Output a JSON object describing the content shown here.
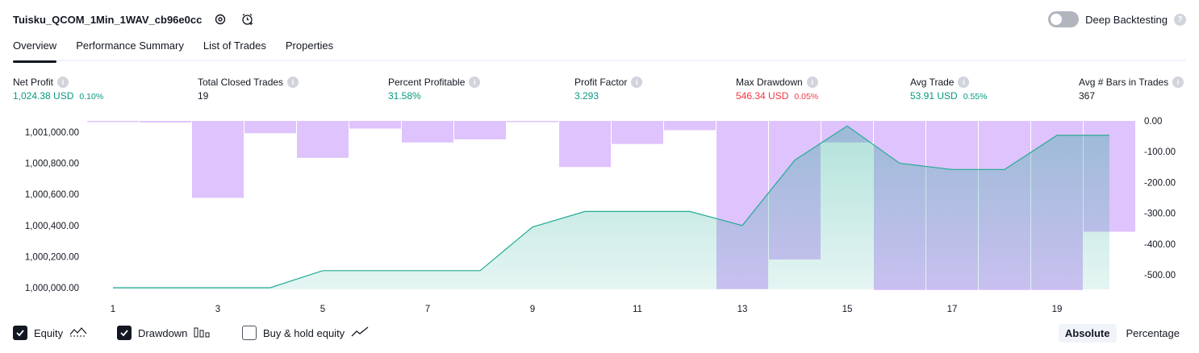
{
  "header": {
    "strategy_name": "Tuisku_QCOM_1Min_1WAV_cb96e0cc",
    "settings_icon": "gear-icon",
    "alert_icon": "add-alert-clock-icon",
    "deep_backtesting_label": "Deep Backtesting",
    "deep_backtesting_enabled": false
  },
  "tabs": [
    {
      "label": "Overview",
      "active": true
    },
    {
      "label": "Performance Summary",
      "active": false
    },
    {
      "label": "List of Trades",
      "active": false
    },
    {
      "label": "Properties",
      "active": false
    }
  ],
  "stats": {
    "net_profit": {
      "label": "Net Profit",
      "value": "1,024.38 USD",
      "pct": "0.10%"
    },
    "total_closed_trades": {
      "label": "Total Closed Trades",
      "value": "19"
    },
    "percent_profitable": {
      "label": "Percent Profitable",
      "value": "31.58%"
    },
    "profit_factor": {
      "label": "Profit Factor",
      "value": "3.293"
    },
    "max_drawdown": {
      "label": "Max Drawdown",
      "value": "546.34 USD",
      "pct": "0.05%"
    },
    "avg_trade": {
      "label": "Avg Trade",
      "value": "53.91 USD",
      "pct": "0.55%"
    },
    "avg_bars": {
      "label": "Avg # Bars in Trades",
      "value": "367"
    }
  },
  "colors": {
    "profit_green": "#089981",
    "loss_red": "#f23645",
    "equity_line": "#22ab94",
    "drawdown_bar": "#d9b8fb",
    "text": "#131722"
  },
  "chart_data": {
    "type": "area",
    "x": [
      1,
      2,
      3,
      4,
      5,
      6,
      7,
      8,
      9,
      10,
      11,
      12,
      13,
      14,
      15,
      16,
      17,
      18,
      19,
      20
    ],
    "x_tick_labels": [
      "1",
      "3",
      "5",
      "7",
      "9",
      "11",
      "13",
      "15",
      "17",
      "19"
    ],
    "x_tick_values": [
      1,
      3,
      5,
      7,
      9,
      11,
      13,
      15,
      17,
      19
    ],
    "series": [
      {
        "name": "Equity",
        "axis": "left",
        "values": [
          1000000,
          1000000,
          1000000,
          1000000,
          1000110,
          1000110,
          1000110,
          1000110,
          1000390,
          1000490,
          1000490,
          1000490,
          1000400,
          1000820,
          1001040,
          1000800,
          1000760,
          1000760,
          1000980,
          1000980
        ]
      },
      {
        "name": "Drawdown",
        "axis": "right",
        "type": "bar",
        "values": [
          0,
          -5,
          -250,
          -40,
          -120,
          -25,
          -70,
          -60,
          0,
          -150,
          -75,
          -30,
          -546.34,
          -450,
          -70,
          -590,
          -780,
          -1100,
          -880,
          -360
        ]
      }
    ],
    "left_axis": {
      "ylim": [
        999990,
        1001040
      ],
      "tick_values": [
        1000000,
        1000200,
        1000400,
        1000600,
        1000800,
        1001000
      ],
      "tick_labels": [
        "1,000,000.00",
        "1,000,200.00",
        "1,000,400.00",
        "1,000,600.00",
        "1,000,800.00",
        "1,001,000.00"
      ]
    },
    "right_axis": {
      "ylim": [
        -550,
        0
      ],
      "tick_values": [
        0,
        -100,
        -200,
        -300,
        -400,
        -500
      ],
      "tick_labels": [
        "0.00",
        "-100.00",
        "-200.00",
        "-300.00",
        "-400.00",
        "-500.00"
      ]
    },
    "grid": false
  },
  "footer": {
    "legend": [
      {
        "label": "Equity",
        "checked": true,
        "icon": "equity-line-icon"
      },
      {
        "label": "Drawdown",
        "checked": true,
        "icon": "drawdown-bars-icon"
      },
      {
        "label": "Buy & hold equity",
        "checked": false,
        "icon": "buy-hold-line-icon"
      }
    ],
    "mode_options": [
      "Absolute",
      "Percentage"
    ],
    "mode_selected": "Absolute"
  }
}
